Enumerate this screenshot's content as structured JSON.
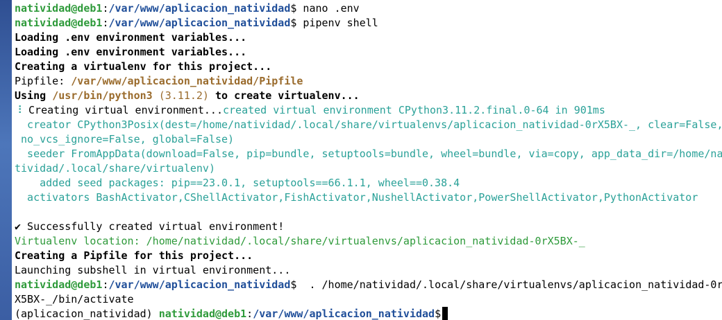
{
  "window": {
    "prompt_user": "natividad@deb1",
    "prompt_sep": ":",
    "prompt_path": "/var/www/aplicacion_natividad",
    "prompt_symbol": "$"
  },
  "terminal": {
    "line01_cmd": " nano .env",
    "line02_cmd": " pipenv shell",
    "line03": "Loading .env environment variables...",
    "line04": "Loading .env environment variables...",
    "line05": "Creating a virtualenv for this project...",
    "line06_label": "Pipfile: ",
    "line06_path": "/var/www/aplicacion_natividad/Pipfile",
    "line07_a": "Using ",
    "line07_b": "/usr/bin/python3",
    "line07_c": " (3.11.2)",
    "line07_d": " to create virtualenv...",
    "line08_spinner": "⠸",
    "line08_a": " Creating virtual environment...",
    "line08_b": "created virtual environment CPython3.11.2.final.0-64 in 901ms",
    "line09": "  creator CPython3Posix(dest=/home/natividad/.local/share/virtualenvs/aplicacion_natividad-0rX5BX-_, clear=False,",
    "line10": " no_vcs_ignore=False, global=False)",
    "line11": "  seeder FromAppData(download=False, pip=bundle, setuptools=bundle, wheel=bundle, via=copy, app_data_dir=/home/na",
    "line12": "tividad/.local/share/virtualenv)",
    "line13": "    added seed packages: pip==23.0.1, setuptools==66.1.1, wheel==0.38.4",
    "line14": "  activators BashActivator,CShellActivator,FishActivator,NushellActivator,PowerShellActivator,PythonActivator",
    "line15": "",
    "line16": "✔ Successfully created virtual environment!",
    "line17": "Virtualenv location: /home/natividad/.local/share/virtualenvs/aplicacion_natividad-0rX5BX-_",
    "line18": "Creating a Pipfile for this project...",
    "line19": "Launching subshell in virtual environment...",
    "line20_cmd": "  . /home/natividad/.local/share/virtualenvs/aplicacion_natividad-0r",
    "line21": "X5BX-_/bin/activate",
    "line22_venv": "(aplicacion_natividad) "
  },
  "colors": {
    "prompt_user": "#2e9a3a",
    "prompt_path": "#1f4e99",
    "pipfile_path": "#9a6b2c",
    "virtualenv_output": "#2aa198",
    "desktop_strip": "#3b5ea3"
  }
}
